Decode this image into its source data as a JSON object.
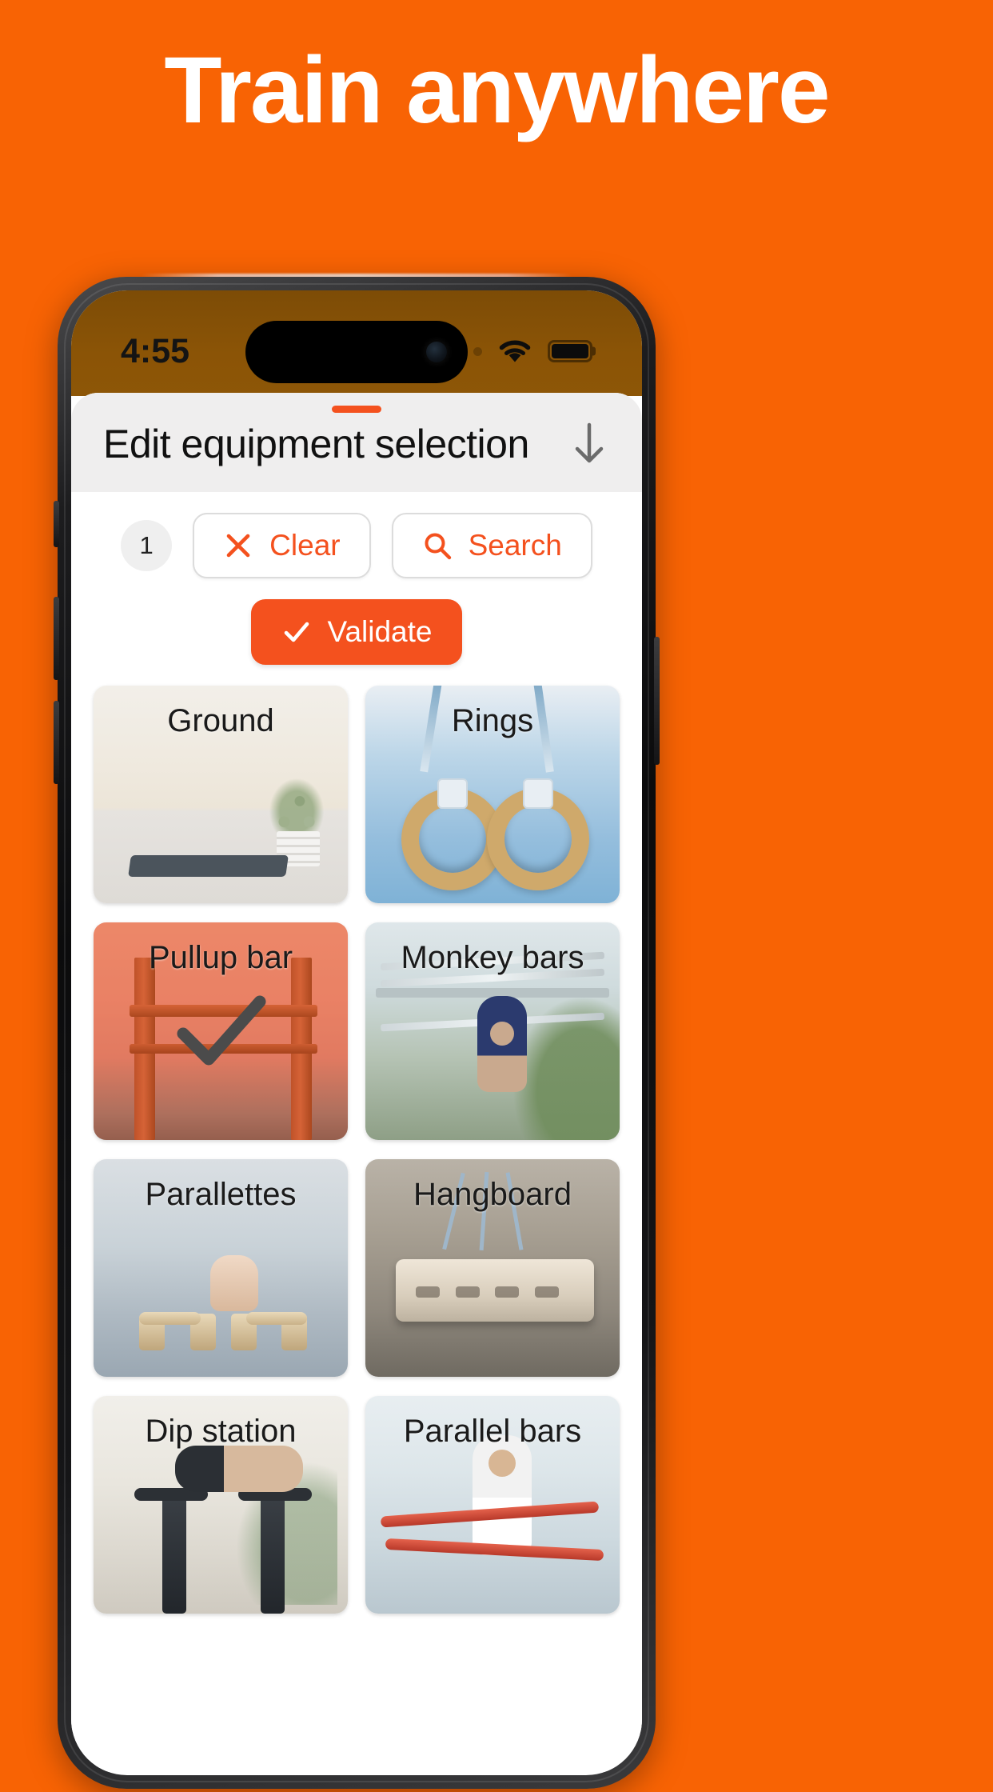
{
  "page": {
    "background_color": "#F86304",
    "headline": "Train anywhere"
  },
  "phone": {
    "status_bar": {
      "time": "4:55",
      "cellular_icon": "cellular-dots-icon",
      "wifi_icon": "wifi-icon",
      "battery_icon": "battery-icon"
    }
  },
  "sheet": {
    "grabber": "drag-handle",
    "title": "Edit equipment selection",
    "dismiss_icon": "arrow-down-icon"
  },
  "actions": {
    "count": "1",
    "clear_label": "Clear",
    "clear_icon": "close-x-icon",
    "search_label": "Search",
    "search_icon": "search-icon",
    "validate_label": "Validate",
    "validate_icon": "check-icon",
    "accent_color": "#F4511E"
  },
  "equipment": [
    {
      "label": "Ground",
      "selected": false
    },
    {
      "label": "Rings",
      "selected": false
    },
    {
      "label": "Pullup bar",
      "selected": true
    },
    {
      "label": "Monkey bars",
      "selected": false
    },
    {
      "label": "Parallettes",
      "selected": false
    },
    {
      "label": "Hangboard",
      "selected": false
    },
    {
      "label": "Dip station",
      "selected": false
    },
    {
      "label": "Parallel bars",
      "selected": false
    }
  ]
}
